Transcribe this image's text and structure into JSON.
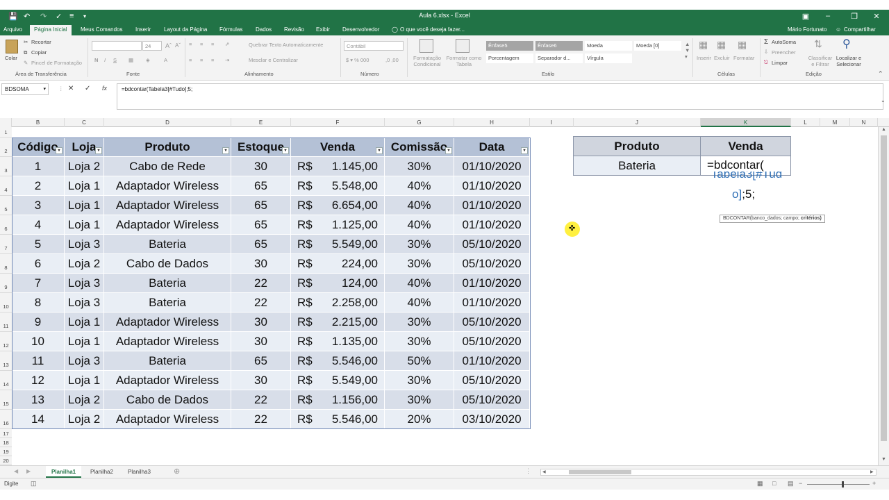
{
  "window": {
    "title": "Aula 6.xlsx - Excel"
  },
  "menu": {
    "tabs": [
      "Arquivo",
      "Página Inicial",
      "Meus Comandos",
      "Inserir",
      "Layout da Página",
      "Fórmulas",
      "Dados",
      "Revisão",
      "Exibir",
      "Desenvolvedor"
    ],
    "tell_me": "O que você deseja fazer...",
    "user": "Mário Fortunato",
    "share": "Compartilhar"
  },
  "ribbon": {
    "clipboard": {
      "paste": "Colar",
      "cut": "Recortar",
      "copy": "Copiar",
      "format_painter": "Pincel de Formatação",
      "label": "Área de Transferência"
    },
    "font": {
      "size": "24",
      "bold": "N",
      "italic": "I",
      "underline": "S",
      "label": "Fonte"
    },
    "alignment": {
      "wrap": "Quebrar Texto Automaticamente",
      "merge": "Mesclar e Centralizar",
      "label": "Alinhamento"
    },
    "number": {
      "format": "Contábil",
      "label": "Número"
    },
    "styles": {
      "cond_format": "Formatação Condicional",
      "format_table": "Formatar como Tabela",
      "gallery": [
        "Ênfase5",
        "Ênfase6",
        "Moeda",
        "Moeda [0]",
        "Porcentagem",
        "Separador d...",
        "Vírgula"
      ],
      "label": "Estilo"
    },
    "cells": {
      "insert": "Inserir",
      "delete": "Excluir",
      "format": "Formatar",
      "label": "Células"
    },
    "editing": {
      "autosum": "AutoSoma",
      "fill": "Preencher",
      "clear": "Limpar",
      "sort": "Classificar e Filtrar",
      "find": "Localizar e Selecionar",
      "label": "Edição"
    }
  },
  "formula_bar": {
    "name_box": "BDSOMA",
    "formula": "=bdcontar(Tabela3[#Tudo];5;",
    "cancel": "✕",
    "enter": "✓",
    "fx": "fx"
  },
  "grid": {
    "columns": [
      "B",
      "C",
      "D",
      "E",
      "F",
      "G",
      "H",
      "I",
      "J",
      "K",
      "L",
      "M",
      "N"
    ],
    "rows": [
      "1",
      "2",
      "3",
      "4",
      "5",
      "6",
      "7",
      "8",
      "9",
      "10",
      "11",
      "12",
      "13",
      "14",
      "15",
      "16",
      "17",
      "18",
      "19",
      "20"
    ],
    "table_headers": [
      "Código",
      "Loja",
      "Produto",
      "Estoque",
      "Venda",
      "Comissão",
      "Data"
    ],
    "table_rows": [
      [
        "1",
        "Loja 2",
        "Cabo de Rede",
        "30",
        "R$",
        "1.145,00",
        "30%",
        "01/10/2020"
      ],
      [
        "2",
        "Loja 1",
        "Adaptador Wireless",
        "65",
        "R$",
        "5.548,00",
        "40%",
        "01/10/2020"
      ],
      [
        "3",
        "Loja 1",
        "Adaptador Wireless",
        "65",
        "R$",
        "6.654,00",
        "40%",
        "01/10/2020"
      ],
      [
        "4",
        "Loja 1",
        "Adaptador Wireless",
        "65",
        "R$",
        "1.125,00",
        "40%",
        "01/10/2020"
      ],
      [
        "5",
        "Loja 3",
        "Bateria",
        "65",
        "R$",
        "5.549,00",
        "30%",
        "05/10/2020"
      ],
      [
        "6",
        "Loja 2",
        "Cabo de Dados",
        "30",
        "R$",
        "224,00",
        "30%",
        "05/10/2020"
      ],
      [
        "7",
        "Loja 3",
        "Bateria",
        "22",
        "R$",
        "124,00",
        "40%",
        "01/10/2020"
      ],
      [
        "8",
        "Loja 3",
        "Bateria",
        "22",
        "R$",
        "2.258,00",
        "40%",
        "01/10/2020"
      ],
      [
        "9",
        "Loja 1",
        "Adaptador Wireless",
        "30",
        "R$",
        "2.215,00",
        "30%",
        "05/10/2020"
      ],
      [
        "10",
        "Loja 1",
        "Adaptador Wireless",
        "30",
        "R$",
        "1.135,00",
        "30%",
        "05/10/2020"
      ],
      [
        "11",
        "Loja 3",
        "Bateria",
        "65",
        "R$",
        "5.546,00",
        "50%",
        "01/10/2020"
      ],
      [
        "12",
        "Loja 1",
        "Adaptador Wireless",
        "30",
        "R$",
        "5.549,00",
        "30%",
        "05/10/2020"
      ],
      [
        "13",
        "Loja 2",
        "Cabo de Dados",
        "22",
        "R$",
        "1.156,00",
        "30%",
        "05/10/2020"
      ],
      [
        "14",
        "Loja 2",
        "Adaptador Wireless",
        "22",
        "R$",
        "5.546,00",
        "20%",
        "03/10/2020"
      ]
    ],
    "criteria": {
      "headers": [
        "Produto",
        "Venda"
      ],
      "product_value": "Bateria",
      "editing_text_line1": "=bdcontar(",
      "editing_text_line2": "Tabela3[#Tud",
      "editing_text_line3": "o];5;"
    },
    "tooltip": {
      "text": "BDCONTAR(banco_dados; campo; ",
      "bold": "critérios)"
    }
  },
  "sheets": [
    "Planilha1",
    "Planilha2",
    "Planilha3"
  ],
  "status": {
    "mode": "Digite"
  }
}
